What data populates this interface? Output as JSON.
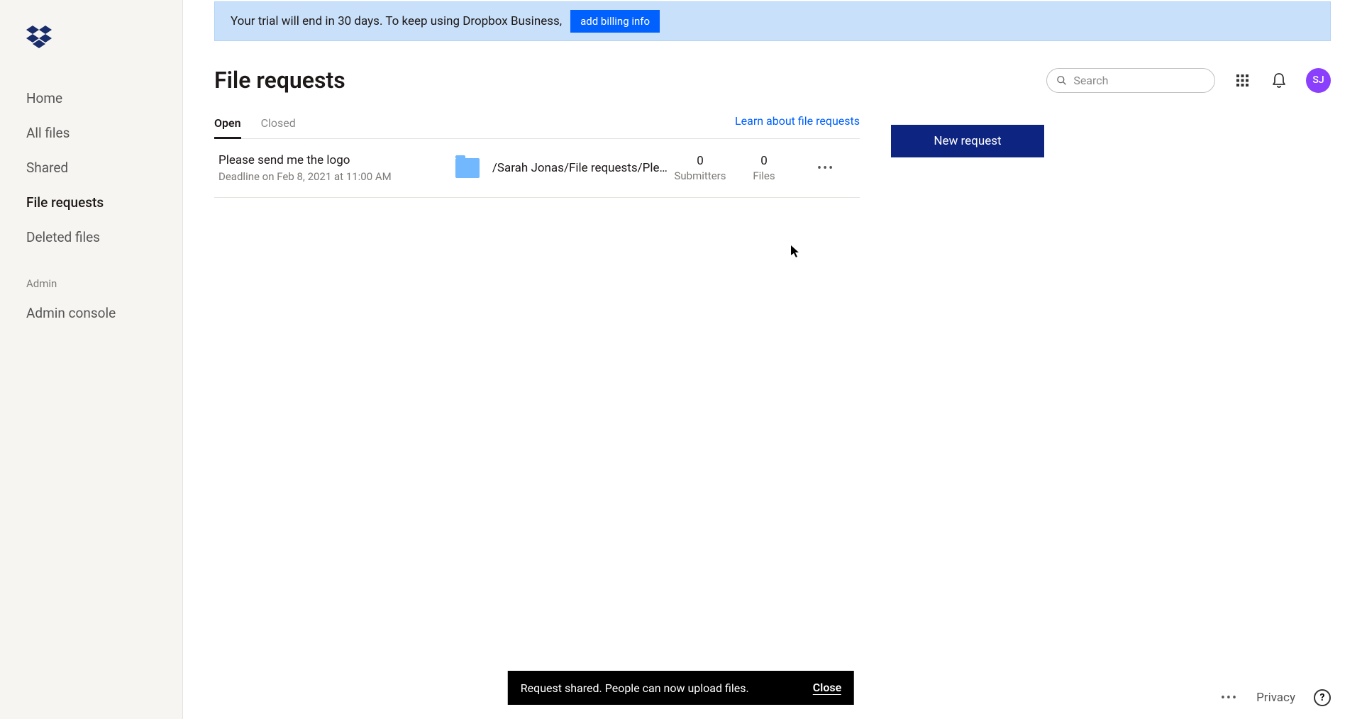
{
  "sidebar": {
    "items": [
      {
        "label": "Home"
      },
      {
        "label": "All files"
      },
      {
        "label": "Shared"
      },
      {
        "label": "File requests"
      },
      {
        "label": "Deleted files"
      }
    ],
    "admin_section_label": "Admin",
    "admin_console_label": "Admin console"
  },
  "banner": {
    "text": "Your trial will end in 30 days. To keep using Dropbox Business,",
    "button": "add billing info"
  },
  "page_title": "File requests",
  "search": {
    "placeholder": "Search"
  },
  "avatar_initials": "SJ",
  "tabs": {
    "open": "Open",
    "closed": "Closed"
  },
  "learn_link": "Learn about file requests",
  "request": {
    "title": "Please send me the logo",
    "deadline": "Deadline on Feb 8, 2021 at 11:00 AM",
    "folder_path": "/Sarah Jonas/File requests/Ple...",
    "submitters_count": "0",
    "submitters_label": "Submitters",
    "files_count": "0",
    "files_label": "Files"
  },
  "new_request_button": "New request",
  "toast": {
    "message": "Request shared. People can now upload files.",
    "close": "Close"
  },
  "footer": {
    "privacy": "Privacy"
  }
}
